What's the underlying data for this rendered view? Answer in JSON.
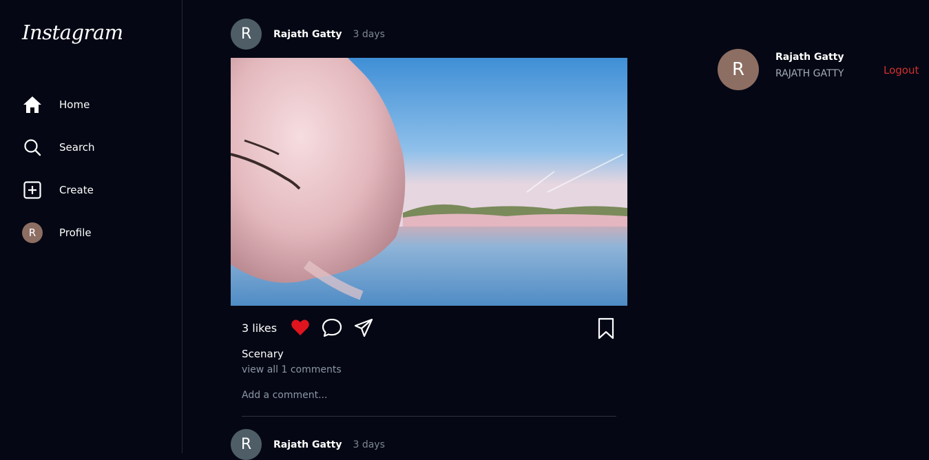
{
  "app": {
    "logo_text": "Instagram"
  },
  "sidebar": {
    "items": [
      {
        "label": "Home",
        "icon": "home-icon"
      },
      {
        "label": "Search",
        "icon": "search-icon"
      },
      {
        "label": "Create",
        "icon": "create-icon"
      },
      {
        "label": "Profile",
        "icon": "avatar",
        "avatar_letter": "R"
      }
    ]
  },
  "posts": [
    {
      "avatar_letter": "R",
      "username": "Rajath Gatty",
      "time": "3 days",
      "likes": "3 likes",
      "liked": true,
      "caption": "Scenary",
      "view_comments": "view all 1 comments",
      "comment_placeholder": "Add a comment..."
    },
    {
      "avatar_letter": "R",
      "username": "Rajath Gatty",
      "time": "3 days"
    }
  ],
  "current_user": {
    "avatar_letter": "R",
    "name": "Rajath Gatty",
    "username": "RAJATH GATTY",
    "logout_label": "Logout"
  },
  "colors": {
    "background": "#050814",
    "like": "#e0141e",
    "logout": "#d32f2f",
    "avatar_brown": "#8d6e63",
    "avatar_slate": "#4e5d66"
  }
}
